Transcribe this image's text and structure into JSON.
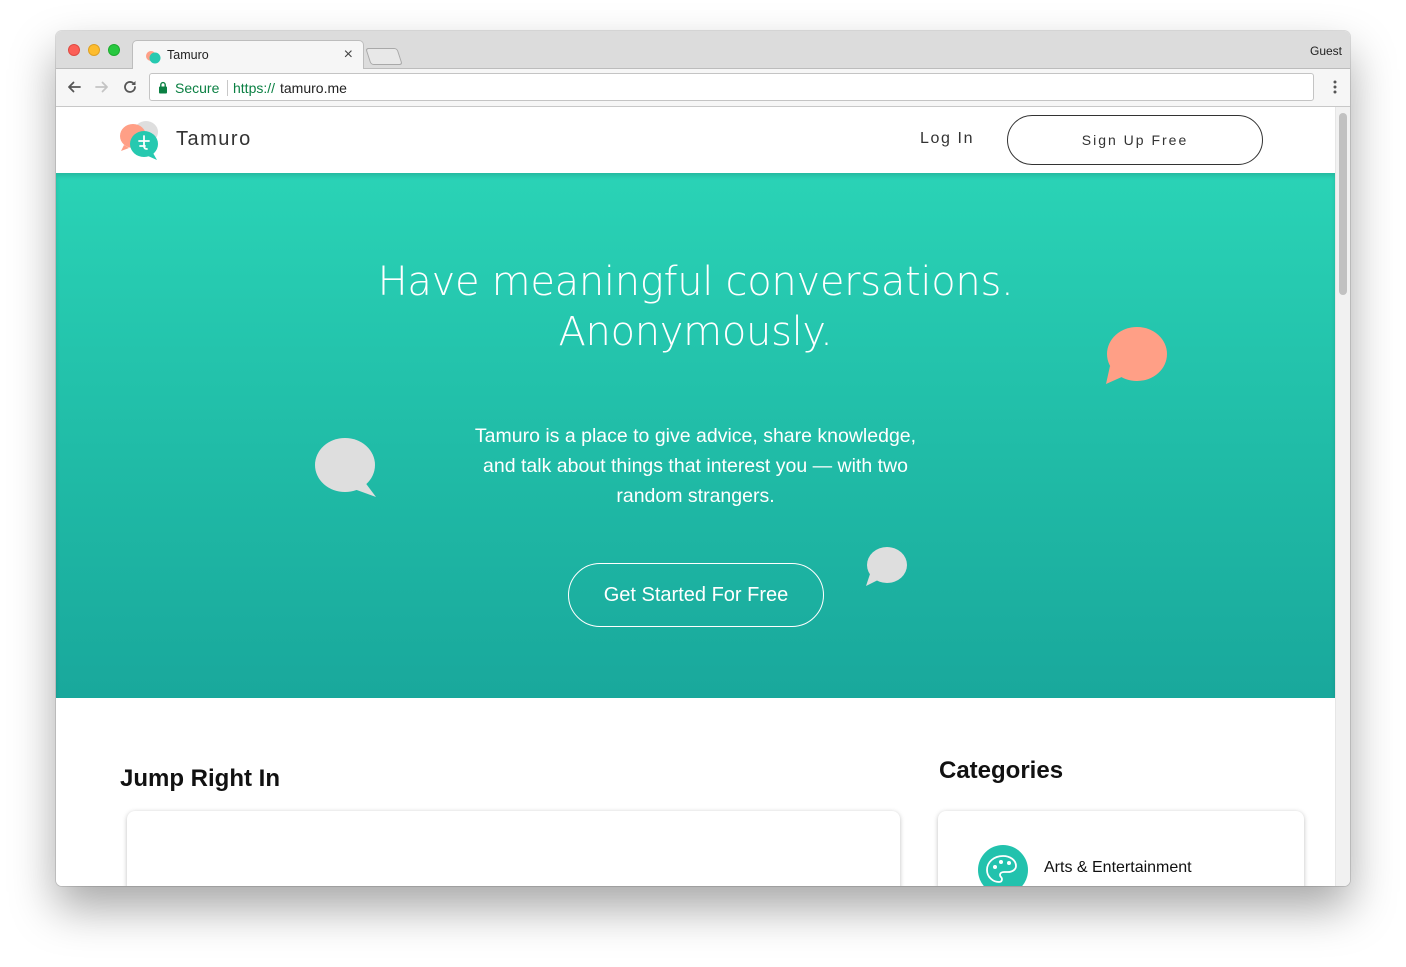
{
  "browser": {
    "tab_title": "Tamuro",
    "tab_close": "×",
    "profile_label": "Guest",
    "secure_label": "Secure",
    "url_scheme": "https://",
    "url_host": "tamuro.me"
  },
  "header": {
    "brand_name": "Tamuro",
    "login_label": "Log In",
    "signup_label": "Sign Up Free"
  },
  "hero": {
    "headline_line1": "Have meaningful conversations.",
    "headline_line2": "Anonymously.",
    "subtext": "Tamuro is a place to give advice, share knowledge, and talk about things that interest you — with two random strangers.",
    "cta_label": "Get Started For Free"
  },
  "sections": {
    "jump_title": "Jump Right In",
    "categories_title": "Categories",
    "categories": [
      {
        "label": "Arts & Entertainment",
        "icon": "palette-icon"
      }
    ]
  },
  "colors": {
    "brand_teal": "#26c9b0",
    "brand_coral": "#ff9f86",
    "bubble_gray": "#dedede"
  }
}
